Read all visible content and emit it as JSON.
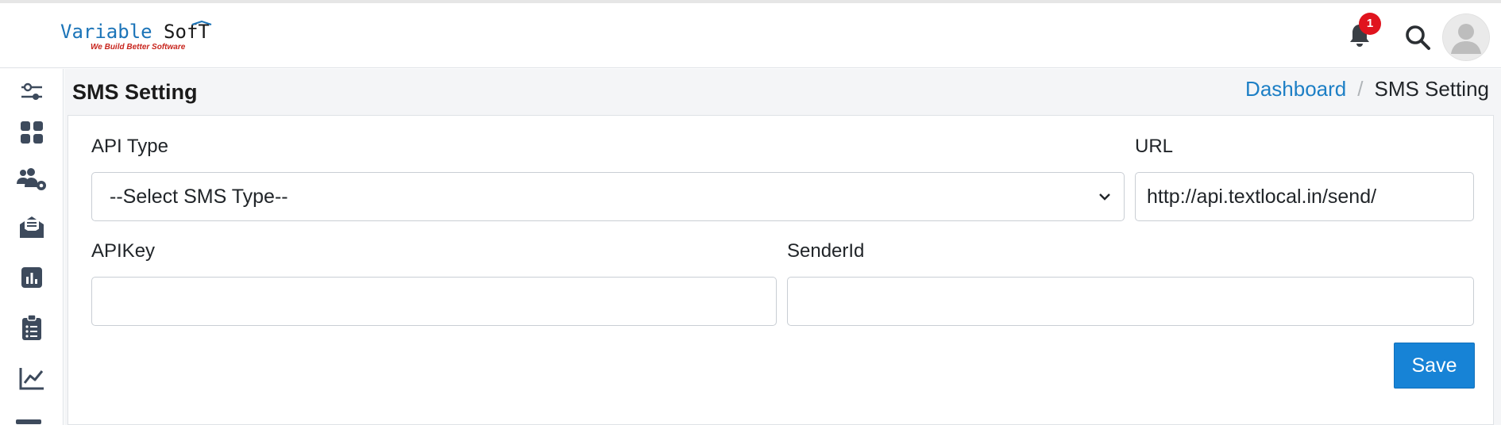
{
  "brand": {
    "name_part1": "Variable",
    "name_part2": "SofT",
    "tagline": "We Build Better Software"
  },
  "header": {
    "notification_count": "1",
    "icons": [
      "bell-icon",
      "search-icon",
      "user-avatar-icon"
    ]
  },
  "sidebar": {
    "items": [
      {
        "icon": "sliders-icon"
      },
      {
        "icon": "grid-icon"
      },
      {
        "icon": "users-gear-icon"
      },
      {
        "icon": "envelope-icon"
      },
      {
        "icon": "report-icon"
      },
      {
        "icon": "clipboard-icon"
      },
      {
        "icon": "line-chart-icon"
      }
    ]
  },
  "page": {
    "title": "SMS Setting",
    "breadcrumb": {
      "link": "Dashboard",
      "separator": "/",
      "current": "SMS Setting"
    }
  },
  "form": {
    "api_type": {
      "label": "API Type",
      "selected": "--Select SMS Type--"
    },
    "url": {
      "label": "URL",
      "value": "http://api.textlocal.in/send/"
    },
    "api_key": {
      "label": "APIKey",
      "value": ""
    },
    "sender_id": {
      "label": "SenderId",
      "value": ""
    },
    "save_label": "Save"
  },
  "colors": {
    "accent": "#1783d6",
    "link": "#1d7fc5",
    "badge": "#e0141e",
    "brand_blue": "#1b74b8",
    "brand_red": "#c8251d",
    "sidebar_icon": "#3d4a5c"
  }
}
